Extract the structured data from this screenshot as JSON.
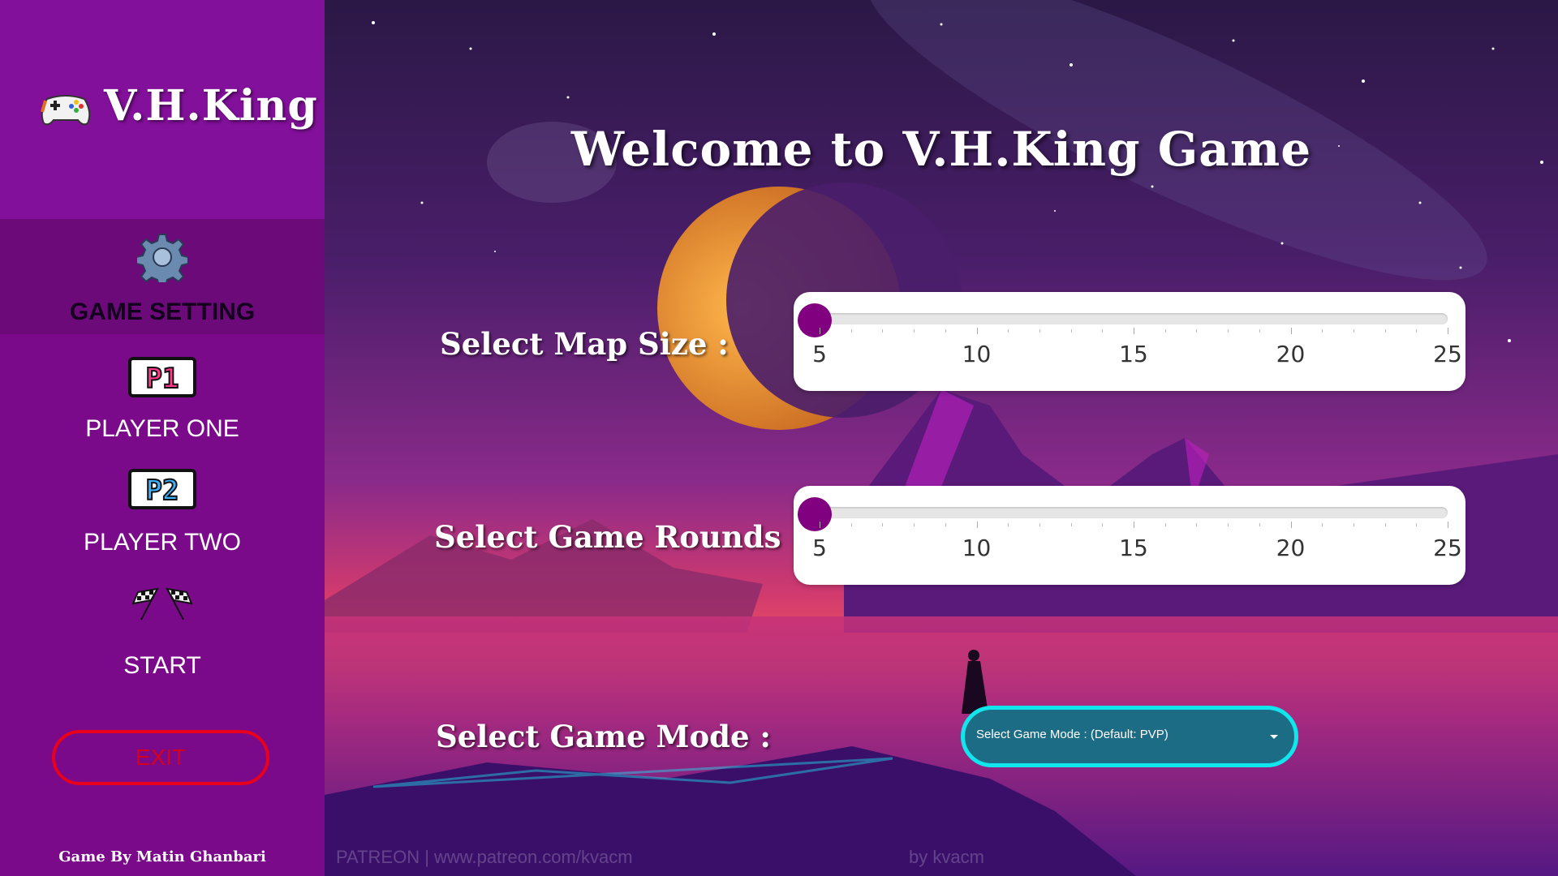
{
  "app": {
    "brand_title": "V.H.King",
    "brand_icon": "gamepad-icon",
    "welcome": "Welcome to V.H.King Game",
    "credit": "Game By Matin Ghanbari"
  },
  "sidebar": {
    "items": [
      {
        "label": "GAME SETTING",
        "icon": "gear-icon",
        "active": true
      },
      {
        "label": "PLAYER ONE",
        "icon": "p1-badge-icon"
      },
      {
        "label": "PLAYER TWO",
        "icon": "p2-badge-icon"
      },
      {
        "label": "START",
        "icon": "checkered-flags-icon"
      }
    ],
    "exit_label": "EXIT"
  },
  "settings": {
    "map_size": {
      "label": "Select Map Size :",
      "min": 5,
      "max": 25,
      "value": 5,
      "ticks": [
        "5",
        "10",
        "15",
        "20",
        "25"
      ]
    },
    "game_rounds": {
      "label": "Select Game Rounds :",
      "min": 5,
      "max": 25,
      "value": 5,
      "ticks": [
        "5",
        "10",
        "15",
        "20",
        "25"
      ]
    },
    "game_mode": {
      "label": "Select Game Mode :",
      "selected": "Select Game Mode : (Default: PVP)"
    }
  },
  "watermarks": {
    "left": "PATREON | www.patreon.com/kvacm",
    "right": "by kvacm"
  },
  "colors": {
    "sidebar": "#7a0a8a",
    "accent": "#80007f",
    "exit": "#e8001c",
    "select_border": "#10e6ec"
  }
}
